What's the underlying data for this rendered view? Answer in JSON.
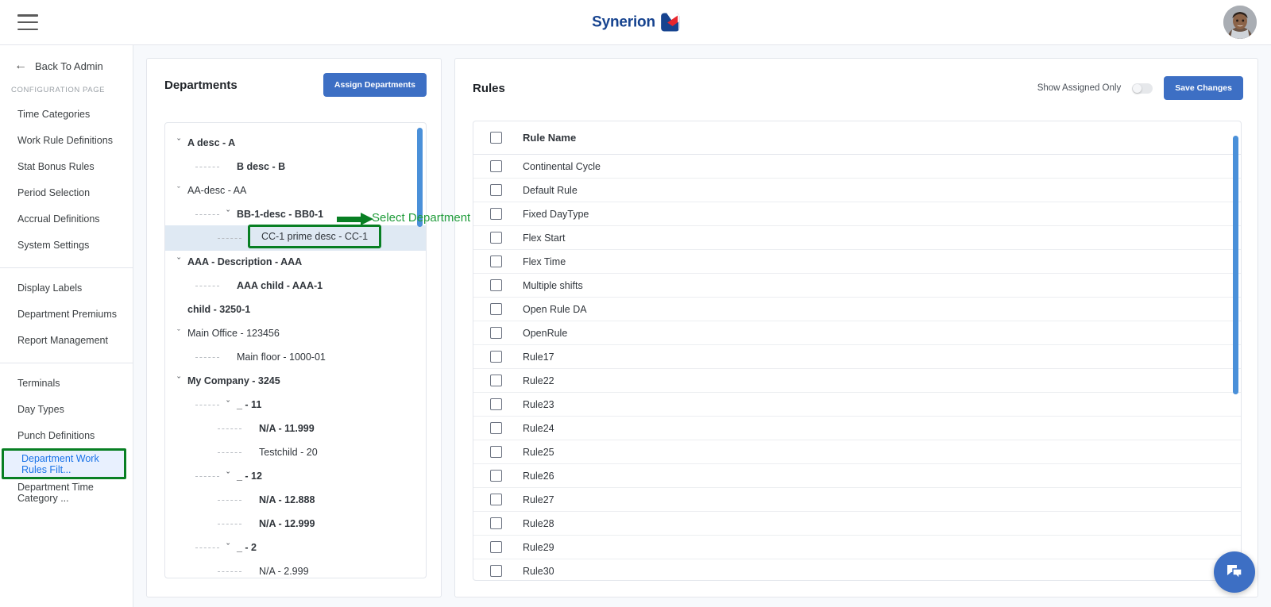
{
  "topbar": {
    "menu_icon": "hamburger-icon",
    "brand_name": "Synerion",
    "avatar_alt": "user-avatar"
  },
  "sidebar": {
    "back_label": "Back To Admin",
    "back_icon": "arrow-left-icon",
    "section_caption": "CONFIGURATION PAGE",
    "group1": [
      {
        "label": "Time Categories"
      },
      {
        "label": "Work Rule Definitions"
      },
      {
        "label": "Stat Bonus Rules"
      },
      {
        "label": "Period Selection"
      },
      {
        "label": "Accrual Definitions"
      },
      {
        "label": "System Settings"
      }
    ],
    "group2": [
      {
        "label": "Display Labels"
      },
      {
        "label": "Department Premiums"
      },
      {
        "label": "Report Management"
      }
    ],
    "group3": [
      {
        "label": "Terminals",
        "active": false
      },
      {
        "label": "Day Types",
        "active": false
      },
      {
        "label": "Punch Definitions",
        "active": false
      },
      {
        "label": "Department Work Rules Filt...",
        "active": true
      },
      {
        "label": "Department Time Category ...",
        "active": false
      }
    ]
  },
  "departments": {
    "title": "Departments",
    "assign_button": "Assign Departments",
    "tree": [
      {
        "label": "A desc - A",
        "depth": 0,
        "caret": true,
        "bold": true,
        "dash": false
      },
      {
        "label": "B desc - B",
        "depth": 1,
        "caret": false,
        "bold": true,
        "dash": true
      },
      {
        "label": "AA-desc - AA",
        "depth": 0,
        "caret": true,
        "bold": false,
        "dash": false
      },
      {
        "label": "BB-1-desc - BB0-1",
        "depth": 1,
        "caret": true,
        "bold": true,
        "dash": true
      },
      {
        "label": "CC-1 prime desc - CC-1",
        "depth": 2,
        "caret": false,
        "bold": false,
        "dash": true,
        "selected": true
      },
      {
        "label": "AAA - Description - AAA",
        "depth": 0,
        "caret": true,
        "bold": true,
        "dash": false
      },
      {
        "label": "AAA child - AAA-1",
        "depth": 1,
        "caret": false,
        "bold": true,
        "dash": true
      },
      {
        "label": "child - 3250-1",
        "depth": 0,
        "caret": false,
        "bold": true,
        "dash": false
      },
      {
        "label": "Main Office - 123456",
        "depth": 0,
        "caret": true,
        "bold": false,
        "dash": false
      },
      {
        "label": "Main floor - 1000-01",
        "depth": 1,
        "caret": false,
        "bold": false,
        "dash": true
      },
      {
        "label": "My Company - 3245",
        "depth": 0,
        "caret": true,
        "bold": true,
        "dash": false
      },
      {
        "label": "_ - 11",
        "depth": 1,
        "caret": true,
        "bold": true,
        "dash": true
      },
      {
        "label": "N/A - 11.999",
        "depth": 2,
        "caret": false,
        "bold": true,
        "dash": true
      },
      {
        "label": "Testchild - 20",
        "depth": 2,
        "caret": false,
        "bold": false,
        "dash": true
      },
      {
        "label": "_ - 12",
        "depth": 1,
        "caret": true,
        "bold": true,
        "dash": true
      },
      {
        "label": "N/A - 12.888",
        "depth": 2,
        "caret": false,
        "bold": true,
        "dash": true
      },
      {
        "label": "N/A - 12.999",
        "depth": 2,
        "caret": false,
        "bold": true,
        "dash": true
      },
      {
        "label": "_ - 2",
        "depth": 1,
        "caret": true,
        "bold": true,
        "dash": true
      },
      {
        "label": "N/A - 2.999",
        "depth": 2,
        "caret": false,
        "bold": false,
        "dash": true
      }
    ]
  },
  "annotation": {
    "text": "Select Department",
    "highlight_color": "#087f23",
    "text_color": "#1f9c3a"
  },
  "rules": {
    "title": "Rules",
    "toggle_label": "Show Assigned Only",
    "toggle_on": false,
    "save_button": "Save Changes",
    "column_header": "Rule Name",
    "items": [
      {
        "name": "Continental Cycle",
        "checked": false
      },
      {
        "name": "Default Rule",
        "checked": false
      },
      {
        "name": "Fixed DayType",
        "checked": false
      },
      {
        "name": "Flex Start",
        "checked": false
      },
      {
        "name": "Flex Time",
        "checked": false
      },
      {
        "name": "Multiple shifts",
        "checked": false
      },
      {
        "name": "Open Rule DA",
        "checked": false
      },
      {
        "name": "OpenRule",
        "checked": false
      },
      {
        "name": "Rule17",
        "checked": false
      },
      {
        "name": "Rule22",
        "checked": false
      },
      {
        "name": "Rule23",
        "checked": false
      },
      {
        "name": "Rule24",
        "checked": false
      },
      {
        "name": "Rule25",
        "checked": false
      },
      {
        "name": "Rule26",
        "checked": false
      },
      {
        "name": "Rule27",
        "checked": false
      },
      {
        "name": "Rule28",
        "checked": false
      },
      {
        "name": "Rule29",
        "checked": false
      },
      {
        "name": "Rule30",
        "checked": false
      }
    ]
  },
  "chat": {
    "icon": "chat-bubble-icon"
  },
  "colors": {
    "accent_blue": "#3d6fc4",
    "brand_blue": "#16438f",
    "brand_red": "#e8262d",
    "annotation_green": "#087f23",
    "active_nav_bg": "#e8f0fe",
    "active_nav_text": "#1a73e8"
  }
}
